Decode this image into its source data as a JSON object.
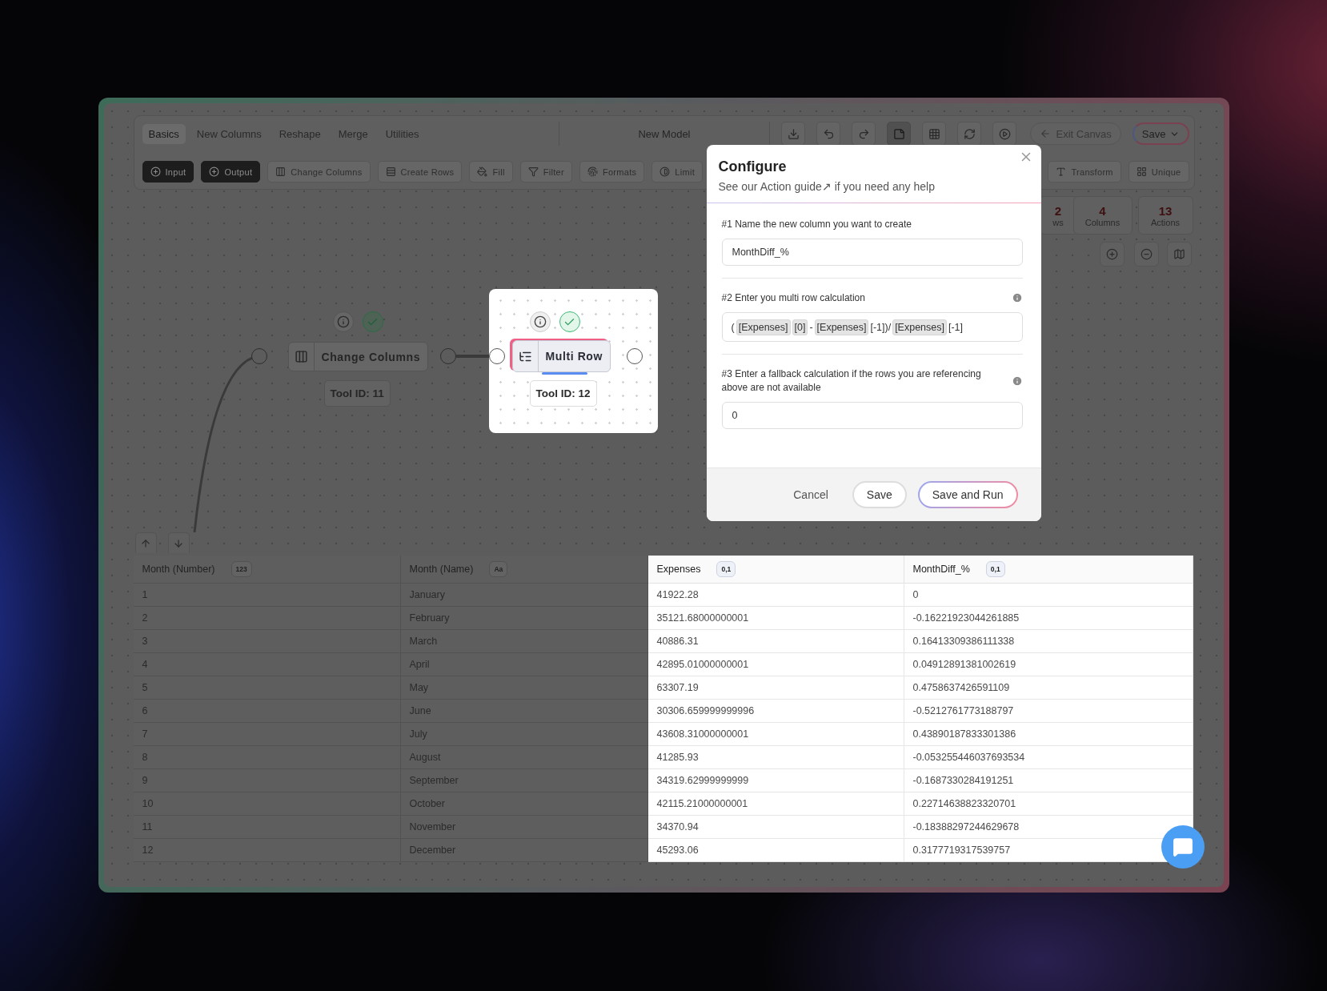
{
  "top_bar": {
    "tabs": [
      {
        "label": "Basics",
        "selected": true
      },
      {
        "label": "New Columns",
        "selected": false
      },
      {
        "label": "Reshape",
        "selected": false
      },
      {
        "label": "Merge",
        "selected": false
      },
      {
        "label": "Utilities",
        "selected": false
      }
    ],
    "title": "New Model",
    "tools": [
      {
        "kind": "download",
        "selected": false
      },
      {
        "kind": "undo",
        "selected": false
      },
      {
        "kind": "redo",
        "selected": false
      },
      {
        "kind": "note",
        "selected": true
      },
      {
        "kind": "grid",
        "selected": false
      },
      {
        "kind": "refresh",
        "selected": false
      },
      {
        "kind": "run",
        "selected": false
      }
    ],
    "exit_button": "Exit Canvas",
    "save_button": "Save"
  },
  "toolbar": [
    {
      "label": "Input",
      "kind": "input"
    },
    {
      "label": "Output",
      "kind": "output"
    },
    {
      "label": "Change Columns",
      "kind": "columns"
    },
    {
      "label": "Create Rows",
      "kind": "rows"
    },
    {
      "label": "Fill",
      "kind": "fill"
    },
    {
      "label": "Filter",
      "kind": "filter"
    },
    {
      "label": "Formats",
      "kind": "formats"
    },
    {
      "label": "Limit",
      "kind": "limit"
    },
    {
      "label": "Transform",
      "kind": "transform"
    },
    {
      "label": "Unique",
      "kind": "unique"
    }
  ],
  "canvas": {
    "nodes": [
      {
        "label": "Change Columns",
        "tool_id": "Tool ID: 11",
        "kind": "columns",
        "focused": false,
        "valid": true
      },
      {
        "label": "Multi Row",
        "tool_id": "Tool ID: 12",
        "kind": "multi_row",
        "focused": true,
        "valid": true
      }
    ],
    "stats": [
      {
        "value": "2",
        "label": "ws"
      },
      {
        "value": "4",
        "label": "Columns"
      },
      {
        "value": "13",
        "label": "Actions"
      }
    ]
  },
  "dialog": {
    "title": "Configure",
    "subtitle_before": "See our",
    "link": "Action guide↗",
    "subtitle_after": "if you need any help",
    "steps": [
      {
        "label": "#1 Name the new column you want to create",
        "info": false,
        "kind": "text",
        "value": "MonthDiff_%"
      },
      {
        "label": "#2 Enter you multi row calculation",
        "info": true,
        "kind": "formula",
        "tokens": [
          {
            "text": "(",
            "kind": "plain"
          },
          {
            "text": "[Expenses]",
            "kind": "chip"
          },
          {
            "text": "[0]",
            "kind": "chip"
          },
          {
            "text": "-",
            "kind": "plain"
          },
          {
            "text": "[Expenses]",
            "kind": "chip"
          },
          {
            "text": "[-1])/",
            "kind": "plain"
          },
          {
            "text": "[Expenses]",
            "kind": "chip"
          },
          {
            "text": "[-1]",
            "kind": "plain"
          }
        ]
      },
      {
        "label": "#3 Enter a fallback calculation if the rows you are referencing above are not available",
        "info": true,
        "kind": "text",
        "value": "0"
      }
    ],
    "cancel": "Cancel",
    "save": "Save",
    "save_and_run": "Save and Run"
  },
  "table": {
    "columns": [
      {
        "label": "Month (Number)",
        "type": "123",
        "highlighted": false
      },
      {
        "label": "Month (Name)",
        "type": "Aa",
        "highlighted": false
      },
      {
        "label": "Expenses",
        "type": "0,1",
        "highlighted": true
      },
      {
        "label": "MonthDiff_%",
        "type": "0,1",
        "highlighted": true
      }
    ],
    "rows": [
      [
        "1",
        "January",
        "41922.28",
        "0"
      ],
      [
        "2",
        "February",
        "35121.68000000001",
        "-0.16221923044261885"
      ],
      [
        "3",
        "March",
        "40886.31",
        "0.16413309386111338"
      ],
      [
        "4",
        "April",
        "42895.01000000001",
        "0.04912891381002619"
      ],
      [
        "5",
        "May",
        "63307.19",
        "0.4758637426591109"
      ],
      [
        "6",
        "June",
        "30306.659999999996",
        "-0.5212761773188797"
      ],
      [
        "7",
        "July",
        "43608.31000000001",
        "0.43890187833301386"
      ],
      [
        "8",
        "August",
        "41285.93",
        "-0.053255446037693534"
      ],
      [
        "9",
        "September",
        "34319.62999999999",
        "-0.1687330284191251"
      ],
      [
        "10",
        "October",
        "42115.21000000001",
        "0.22714638823320701"
      ],
      [
        "11",
        "November",
        "34370.94",
        "-0.18388297244629678"
      ],
      [
        "12",
        "December",
        "45293.06",
        "0.3177719317539757"
      ]
    ]
  }
}
